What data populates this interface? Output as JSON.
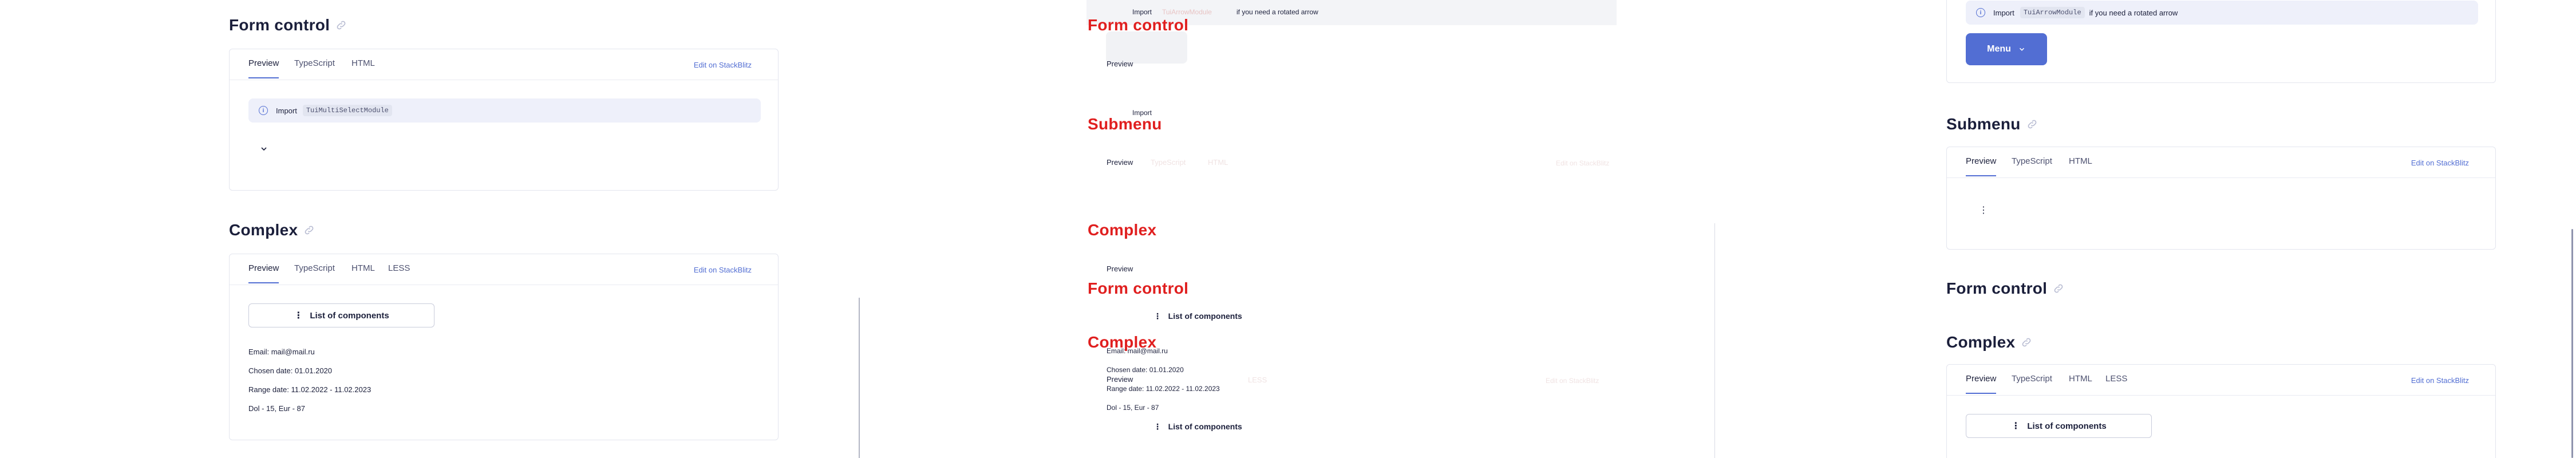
{
  "headings": {
    "form_control": "Form control",
    "complex": "Complex",
    "submenu": "Submenu"
  },
  "tabs": {
    "preview": "Preview",
    "typescript": "TypeScript",
    "html": "HTML",
    "less": "LESS",
    "edit": "Edit on StackBlitz"
  },
  "notices": {
    "import_label": "Import",
    "multiselect_module": "TuiMultiSelectModule",
    "arrow_module": "TuiArrowModule",
    "rotated_arrow_note": "if you need a rotated arrow"
  },
  "buttons": {
    "list_of_components": "List of components",
    "menu": "Menu"
  },
  "complex_lines": {
    "email": "Email: mail@mail.ru",
    "chosen_date": "Chosen date: 01.01.2020",
    "range_date": "Range date: 11.02.2022 - 11.02.2023",
    "currency": "Dol - 15, Eur - 87"
  },
  "colors": {
    "accent": "#526ed3",
    "text": "#1b1f3b",
    "overlay_red": "#e01f1f"
  }
}
